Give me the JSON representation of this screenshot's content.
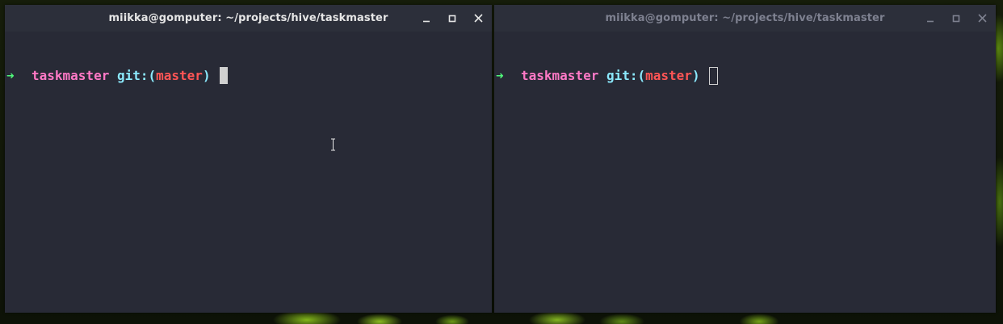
{
  "colors": {
    "terminal_bg": "#282a36",
    "titlebar_bg": "#2c2f3a",
    "arrow": "#50fa7b",
    "directory": "#ff79c6",
    "git_label": "#8be9fd",
    "branch": "#ff5555",
    "cursor": "#d0d0d0"
  },
  "windows": [
    {
      "title": "miikka@gomputer: ~/projects/hive/taskmaster",
      "focused": true,
      "controls": [
        "minimize-icon",
        "maximize-icon",
        "close-icon"
      ],
      "prompt": {
        "arrow": "➜",
        "directory": "taskmaster",
        "git_prefix": "git:(",
        "branch": "master",
        "git_suffix": ")"
      }
    },
    {
      "title": "miikka@gomputer: ~/projects/hive/taskmaster",
      "focused": false,
      "controls": [
        "minimize-icon",
        "maximize-icon",
        "close-icon"
      ],
      "prompt": {
        "arrow": "➜",
        "directory": "taskmaster",
        "git_prefix": "git:(",
        "branch": "master",
        "git_suffix": ")"
      }
    }
  ]
}
